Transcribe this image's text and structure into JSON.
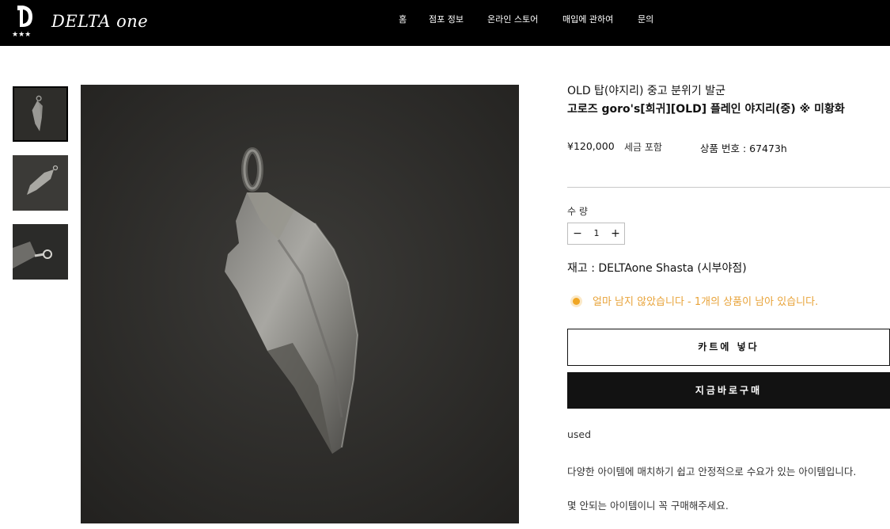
{
  "header": {
    "logo_text": "DELTA one",
    "nav": [
      "홈",
      "점포 정보",
      "온라인 스토어",
      "매입에 관하여",
      "문의"
    ]
  },
  "gallery": {
    "thumbnails": [
      "arrowhead-pendant-front",
      "arrowhead-pendant-angled",
      "pendant-bail-closeup"
    ],
    "selected_index": 0
  },
  "product": {
    "title_line1": "OLD 탑(야지리) 중고 분위기 발군",
    "title_line2": "고로즈 goro's[희귀][OLD] 플레인 야지리(중) ※ 미황화",
    "price": "¥120,000",
    "tax_note": "세금 포함",
    "sku": "상품 번호 : 67473h",
    "quantity_label": "수 량",
    "quantity_value": "1",
    "quantity_minus": "−",
    "quantity_plus": "+",
    "stock_location": "재고 : DELTAone Shasta (시부야점)",
    "low_stock_message": "얼마 남지 않았습니다 - 1개의 상품이 남아 있습니다.",
    "add_to_cart_label": "카트에 넣다",
    "buy_now_label": "지금바로구매",
    "description": [
      "used",
      "다양한 아이템에 매치하기 쉽고 안정적으로 수요가 있는 아이템입니다.",
      "몇 안되는 아이템이니 꼭 구매해주세요."
    ]
  },
  "colors": {
    "header_bg": "#000000",
    "accent_warning": "#f0a623",
    "button_dark": "#121212",
    "divider": "#c8c8c8"
  }
}
